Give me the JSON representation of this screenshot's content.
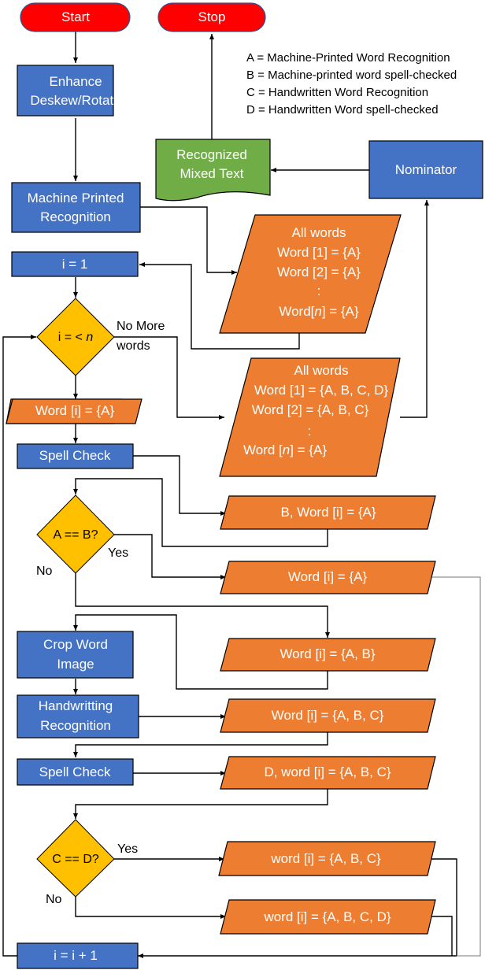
{
  "colors": {
    "terminal": "#ff0000",
    "process": "#4472c4",
    "data": "#ed7d31",
    "decision": "#ffc000",
    "document": "#70ad47",
    "stroke": "#000000"
  },
  "legend": [
    "A = Machine-Printed Word Recognition",
    "B = Machine-printed word spell-checked",
    "C = Handwritten Word Recognition",
    "D = Handwritten Word spell-checked"
  ],
  "nodes": {
    "start": {
      "lines": [
        "Start"
      ]
    },
    "stop": {
      "lines": [
        "Stop"
      ]
    },
    "enhance": {
      "lines": [
        "Enhance",
        "Deskew/Rotate"
      ]
    },
    "machine_printed": {
      "lines": [
        "Machine Printed",
        "Recognition"
      ]
    },
    "recognized_text": {
      "lines": [
        "Recognized",
        "Mixed Text"
      ]
    },
    "nominator": {
      "lines": [
        "Nominator"
      ]
    },
    "all_words_a": {
      "lines": [
        "All words",
        "Word [1] = {A}",
        "Word [2] = {A}",
        ":",
        "Word[n] = {A}"
      ]
    },
    "i_eq_1": {
      "lines": [
        "i = 1"
      ]
    },
    "loop_check": {
      "lines": [
        "i = < n"
      ]
    },
    "all_words_final": {
      "lines": [
        "All words",
        "Word [1] = {A, B, C, D}",
        "Word [2] = {A, B, C}",
        ":",
        "Word [n] = {A}"
      ]
    },
    "word_i_a": {
      "lines": [
        "Word [i] = {A}"
      ]
    },
    "spell_check_1": {
      "lines": [
        "Spell Check"
      ]
    },
    "b_word_i": {
      "lines": [
        "B, Word [i] = {A}"
      ]
    },
    "a_eq_b": {
      "lines": [
        "A == B?"
      ]
    },
    "word_i_a_yes": {
      "lines": [
        "Word [i] = {A}"
      ]
    },
    "crop_word": {
      "lines": [
        "Crop Word",
        "Image"
      ]
    },
    "word_i_ab": {
      "lines": [
        "Word [i] = {A, B}"
      ]
    },
    "handwriting": {
      "lines": [
        "Handwritting",
        "Recognition"
      ]
    },
    "word_i_abc": {
      "lines": [
        "Word [i] = {A, B, C}"
      ]
    },
    "spell_check_2": {
      "lines": [
        "Spell Check"
      ]
    },
    "d_word_i": {
      "lines": [
        "D, word [i] = {A, B, C}"
      ]
    },
    "c_eq_d": {
      "lines": [
        "C == D?"
      ]
    },
    "word_i_abc_yes": {
      "lines": [
        "word [i] = {A, B, C}"
      ]
    },
    "word_i_abcd": {
      "lines": [
        "word [i] = {A, B, C, D}"
      ]
    },
    "increment": {
      "lines": [
        "i = i + 1"
      ]
    }
  },
  "edge_labels": {
    "no_more_words_1": "No More",
    "no_more_words_2": "words",
    "ab_yes": "Yes",
    "ab_no": "No",
    "cd_yes": "Yes",
    "cd_no": "No"
  }
}
